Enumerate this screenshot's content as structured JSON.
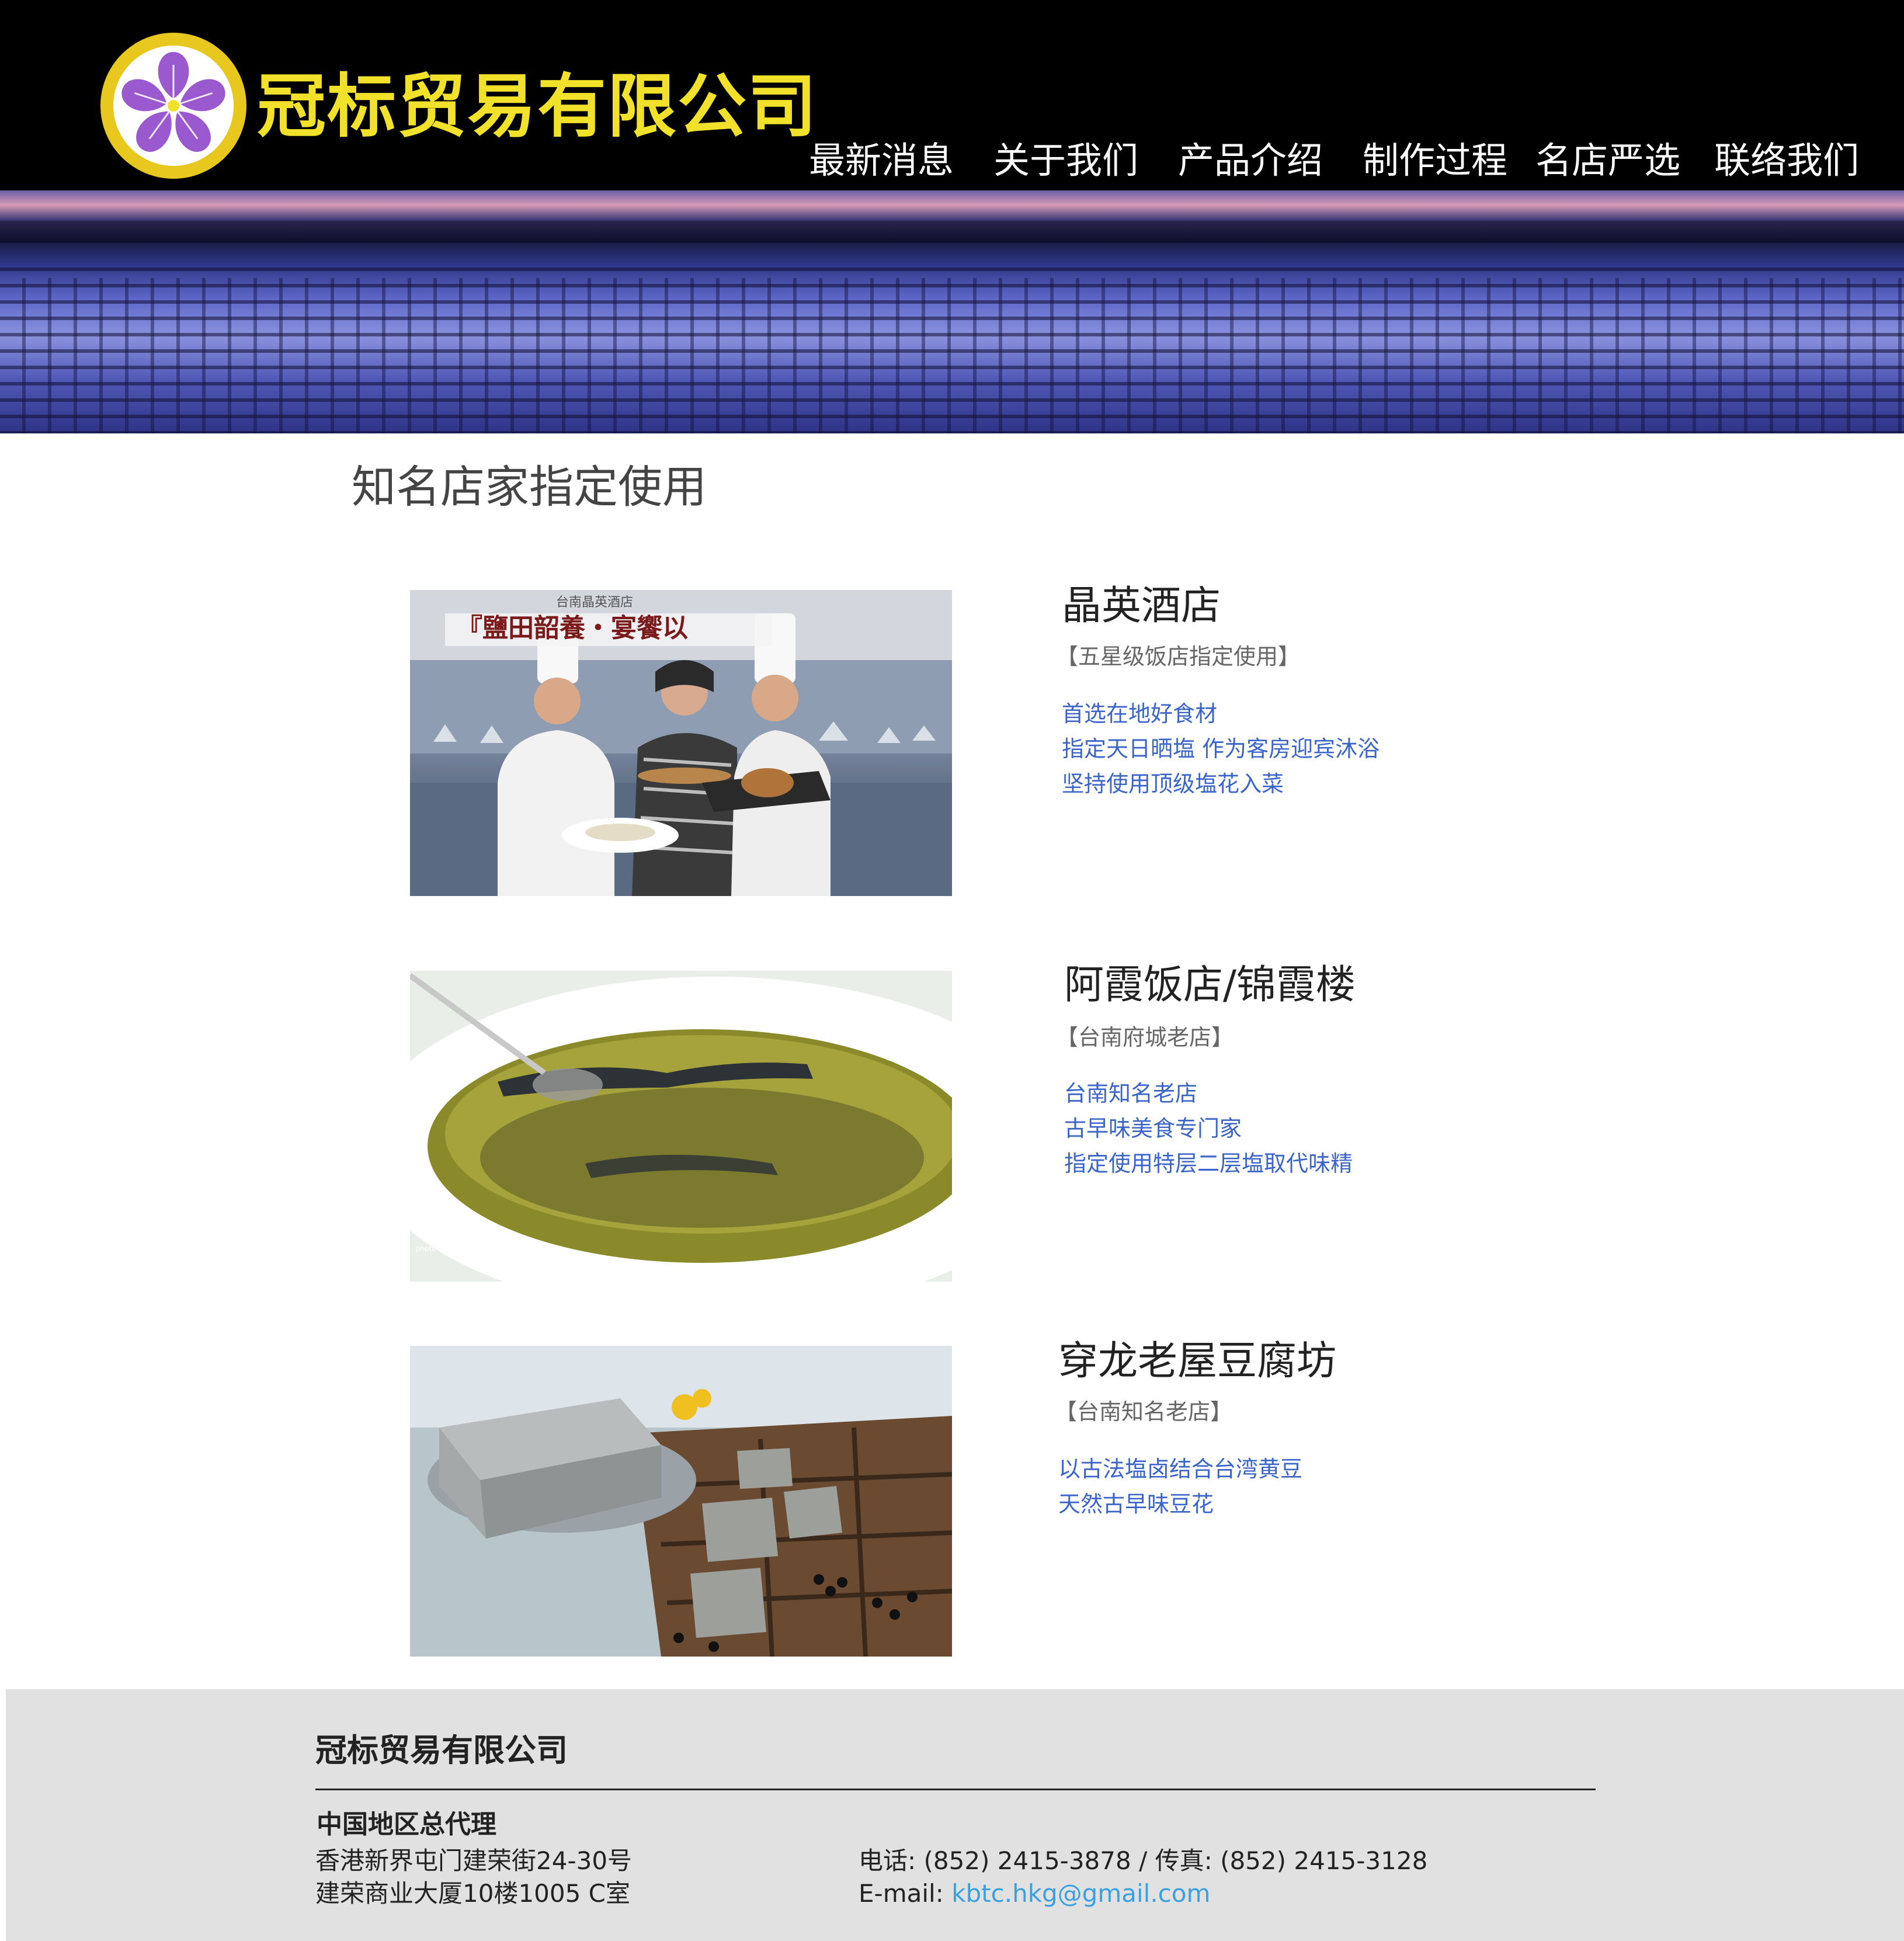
{
  "header": {
    "company_name": "冠标贸易有限公司",
    "nav": [
      {
        "label": "最新消息"
      },
      {
        "label": "关于我们"
      },
      {
        "label": "产品介绍"
      },
      {
        "label": "制作过程"
      },
      {
        "label": "名店严选"
      },
      {
        "label": "联络我们"
      }
    ]
  },
  "colors": {
    "header_bg": "#000000",
    "brand_yellow": "#f2e12a",
    "logo_flower": "#9b59d0",
    "link_blue": "#3a64c8",
    "footer_bg": "#e1e1e1",
    "email_blue": "#3aa0e0"
  },
  "main": {
    "section_title": "知名店家指定使用",
    "stores": [
      {
        "name": "晶英酒店",
        "tag": "【五星级饭店指定使用】",
        "points": [
          "首选在地好食材",
          "指定天日晒塩 作为客房迎宾沐浴",
          "坚持使用顶级塩花入菜"
        ],
        "photo_caption_top": "台南晶英酒店",
        "photo_caption_main": "『鹽田韶養・宴饗以"
      },
      {
        "name": "阿霞饭店/锦霞楼",
        "tag": "【台南府城老店】",
        "points": [
          "台南知名老店",
          "古早味美食专门家",
          "指定使用特层二层塩取代味精"
        ]
      },
      {
        "name": "穿龙老屋豆腐坊",
        "tag": "【台南知名老店】",
        "points": [
          "以古法塩卤结合台湾黄豆",
          "天然古早味豆花"
        ]
      }
    ]
  },
  "footer": {
    "company_name": "冠标贸易有限公司",
    "region_title": "中国地区总代理",
    "address_line1": "香港新界屯门建荣街24-30号",
    "address_line2": "建荣商业大厦10楼1005 C室",
    "phone_fax": "电话: (852) 2415-3878 / 传真: (852) 2415-3128",
    "email_label": "E-mail: ",
    "email": "kbtc.hkg@gmail.com"
  }
}
